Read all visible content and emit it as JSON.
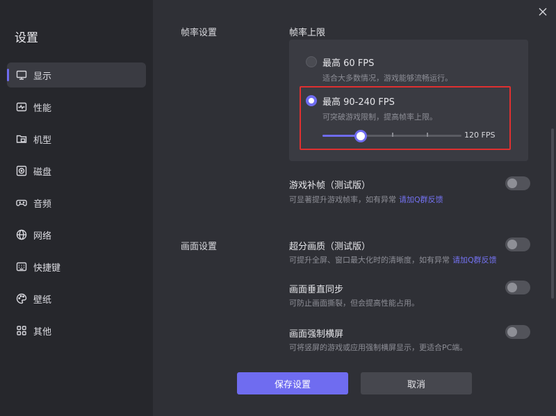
{
  "sidebar": {
    "title": "设置",
    "items": [
      {
        "label": "显示",
        "icon": "monitor-icon",
        "active": true
      },
      {
        "label": "性能",
        "icon": "pulse-icon"
      },
      {
        "label": "机型",
        "icon": "folder-icon"
      },
      {
        "label": "磁盘",
        "icon": "disk-icon"
      },
      {
        "label": "音频",
        "icon": "gamepad-icon"
      },
      {
        "label": "网络",
        "icon": "globe-icon"
      },
      {
        "label": "快捷键",
        "icon": "keyboard-icon"
      },
      {
        "label": "壁纸",
        "icon": "palette-icon"
      },
      {
        "label": "其他",
        "icon": "grid-icon"
      }
    ]
  },
  "framerate": {
    "section_label": "帧率设置",
    "limit_label": "帧率上限",
    "option1": {
      "title": "最高 60 FPS",
      "desc": "适合大多数情况，游戏能够流畅运行。",
      "selected": false
    },
    "option2": {
      "title": "最高 90-240 FPS",
      "desc": "可突破游戏限制，提高帧率上限。",
      "selected": true
    },
    "slider": {
      "min": 90,
      "max": 240,
      "value": 120,
      "value_label": "120 FPS"
    },
    "interp": {
      "title": "游戏补帧（测试版）",
      "desc": "可显著提升游戏帧率，如有异常",
      "link": "请加Q群反馈",
      "enabled": false
    }
  },
  "display": {
    "section_label": "画面设置",
    "superres": {
      "title": "超分画质（测试版）",
      "desc": "可提升全屏、窗口最大化时的清晰度，如有异常",
      "link": "请加Q群反馈",
      "enabled": false
    },
    "vsync": {
      "title": "画面垂直同步",
      "desc": "可防止画面撕裂，但会提高性能占用。",
      "enabled": false
    },
    "landscape": {
      "title": "画面强制横屏",
      "desc": "可将竖屏的游戏或应用强制横屏显示，更适合PC端。",
      "enabled": false
    }
  },
  "buttons": {
    "save": "保存设置",
    "cancel": "取消"
  },
  "colors": {
    "accent": "#6f6cf0",
    "highlight_border": "#e03030"
  }
}
